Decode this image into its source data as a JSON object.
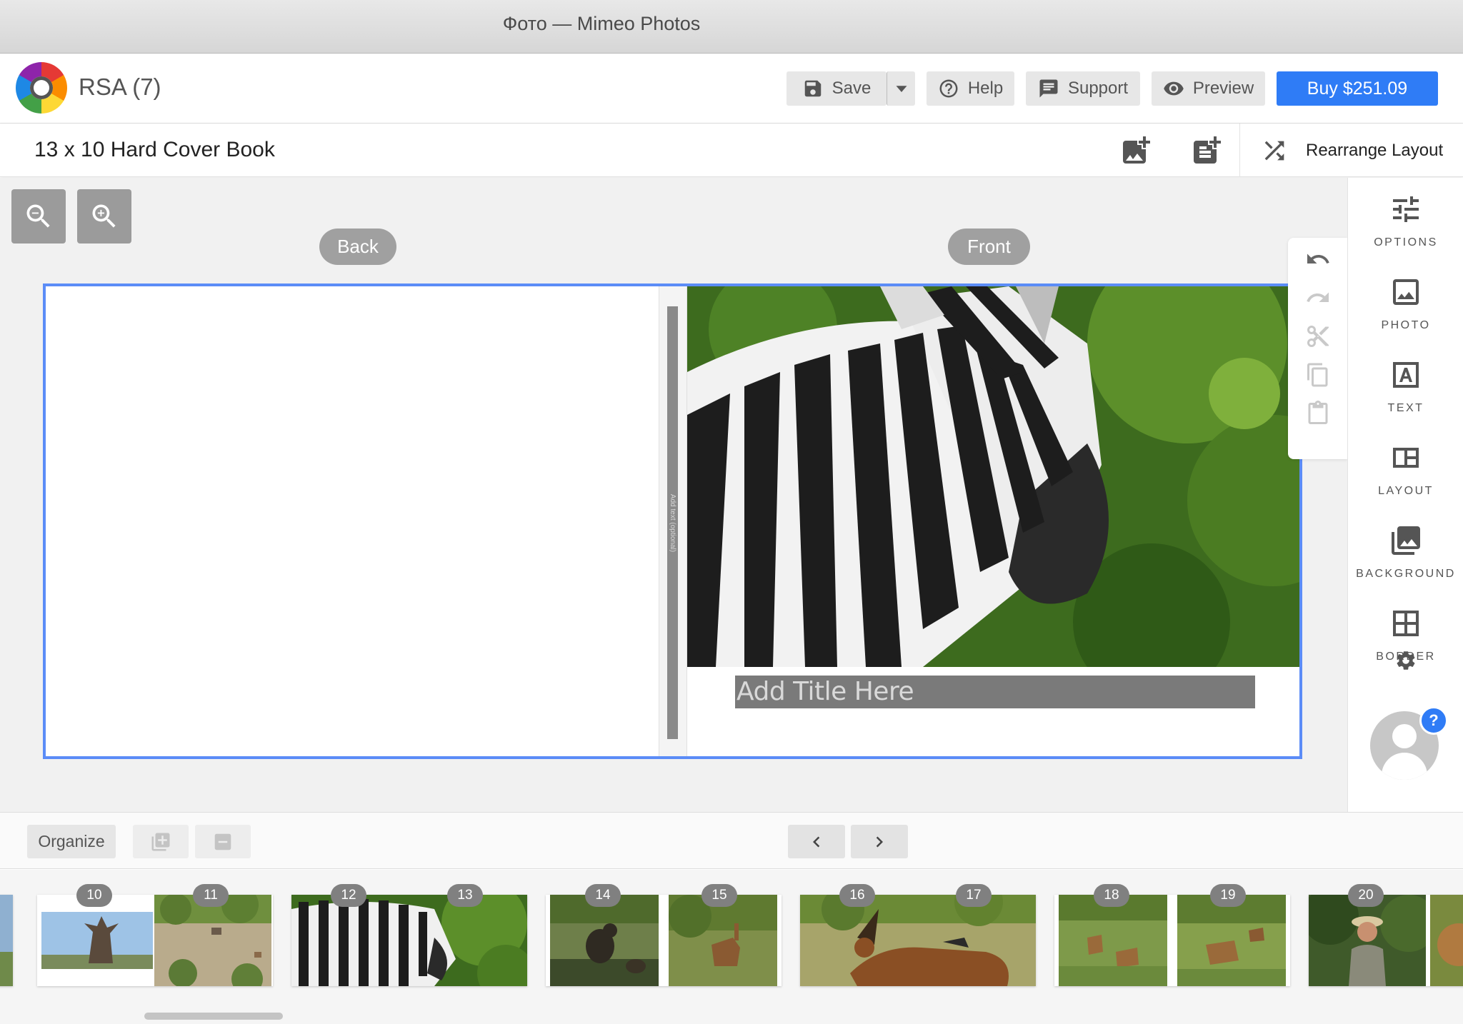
{
  "window": {
    "title": "Фото — Mimeo Photos"
  },
  "header": {
    "project_name": "RSA (7)",
    "save_label": "Save",
    "help_label": "Help",
    "support_label": "Support",
    "preview_label": "Preview",
    "buy_label": "Buy $251.09"
  },
  "subheader": {
    "product_title": "13 x 10 Hard Cover Book",
    "rearrange_label": "Rearrange Layout"
  },
  "canvas": {
    "back_label": "Back",
    "front_label": "Front",
    "spine_placeholder": "Add text (optional)",
    "title_placeholder": "Add Title Here"
  },
  "right_panel": {
    "items": [
      {
        "label": "OPTIONS",
        "icon": "sliders-icon"
      },
      {
        "label": "PHOTO",
        "icon": "photo-icon"
      },
      {
        "label": "TEXT",
        "icon": "text-icon"
      },
      {
        "label": "LAYOUT",
        "icon": "layout-icon"
      },
      {
        "label": "BACKGROUND",
        "icon": "background-icon"
      },
      {
        "label": "BORDER",
        "icon": "border-icon"
      }
    ],
    "help_badge": "?"
  },
  "bottom_bar": {
    "organize_label": "Organize"
  },
  "pages": {
    "p10": "10",
    "p11": "11",
    "p12": "12",
    "p13": "13",
    "p14": "14",
    "p15": "15",
    "p16": "16",
    "p17": "17",
    "p18": "18",
    "p19": "19",
    "p20": "20"
  },
  "colors": {
    "accent": "#2f7cf6",
    "selection": "#5b8cf7"
  }
}
